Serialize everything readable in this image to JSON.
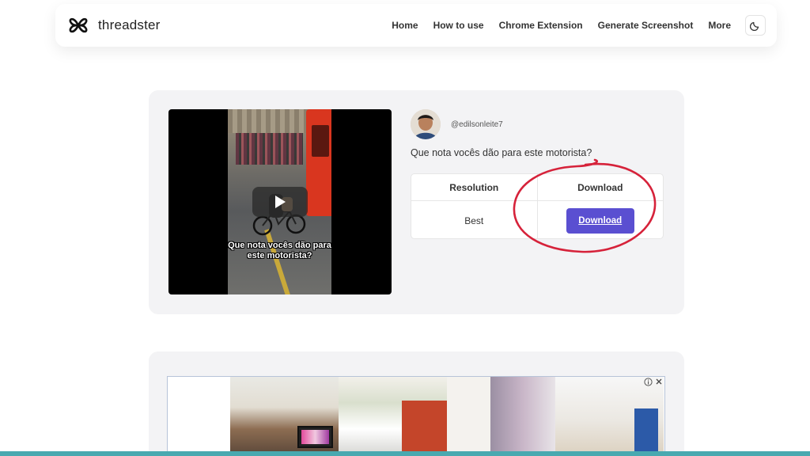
{
  "header": {
    "brand": "threadster",
    "nav": [
      "Home",
      "How to use",
      "Chrome Extension",
      "Generate Screenshot",
      "More"
    ]
  },
  "post": {
    "username": "@edilsonleite7",
    "caption": "Que nota vocês dão para este motorista?",
    "video_caption": "Que nota vocês dão para este motorista?"
  },
  "download_table": {
    "col_resolution": "Resolution",
    "col_download": "Download",
    "resolution_value": "Best",
    "button_label": "Download"
  },
  "colors": {
    "accent": "#5a4fd1",
    "annotation": "#d6223a",
    "card_bg": "#f3f3f5"
  }
}
